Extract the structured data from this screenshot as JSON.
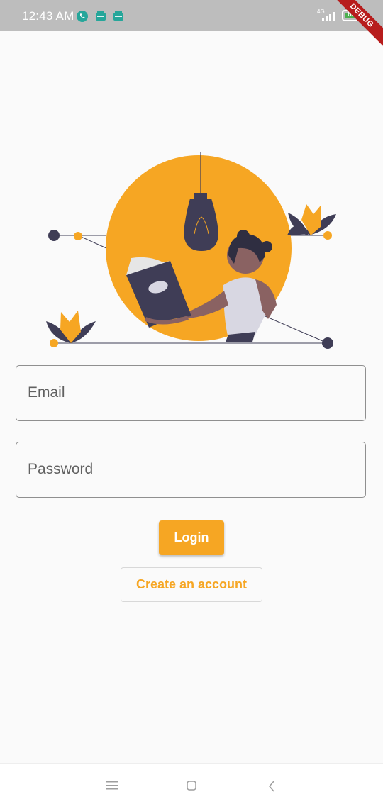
{
  "status_bar": {
    "time": "12:43 AM",
    "network": "4G",
    "battery": "83",
    "icons": [
      "phone-icon",
      "notification-box-icon",
      "notification-box-icon",
      "signal-icon",
      "battery-icon"
    ]
  },
  "debug_banner": {
    "label": "DEBUG"
  },
  "illustration": {
    "name": "woman-reading-book-illustration",
    "accent": "#f6a623",
    "dark": "#3f3d56"
  },
  "form": {
    "email_placeholder": "Email",
    "password_placeholder": "Password"
  },
  "actions": {
    "login_label": "Login",
    "create_label": "Create an account"
  },
  "nav_bar": {
    "icons": [
      "menu-icon",
      "home-square-icon",
      "back-chevron-icon"
    ]
  },
  "colors": {
    "accent": "#f6a623",
    "background": "#fafafa",
    "status_bar": "#bdbdbd"
  }
}
